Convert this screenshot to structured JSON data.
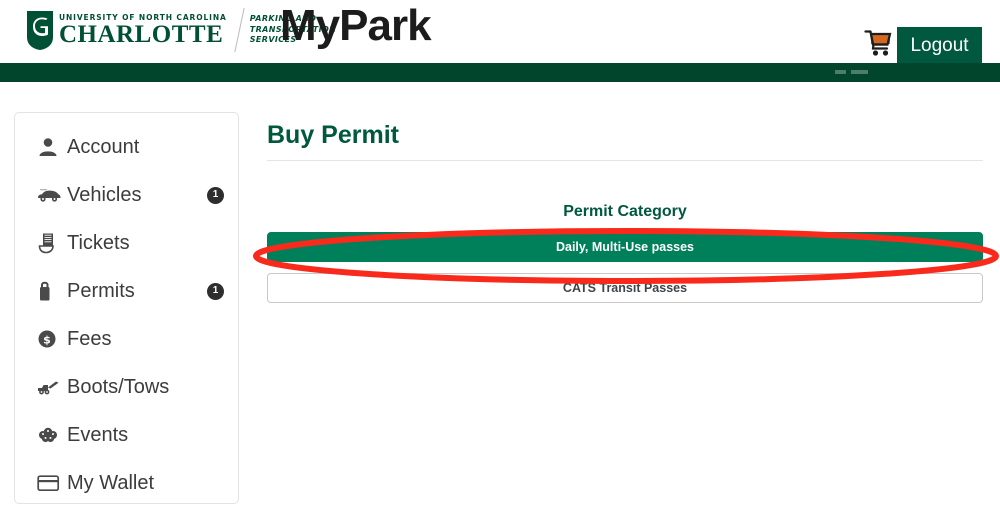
{
  "header": {
    "university_sup": "UNIVERSITY OF NORTH CAROLINA",
    "university_main": "CHARLOTTE",
    "dept_line1": "PARKING AND",
    "dept_line2": "TRANSPORTATION",
    "dept_line3": "SERVICES",
    "app_title": "MyPark",
    "cart_icon": "shopping-cart-icon",
    "logout_label": "Logout",
    "brand_green": "#005035",
    "navbar_green": "#00452c",
    "logout_green": "#00593f"
  },
  "sidebar": {
    "items": [
      {
        "label": "Account",
        "icon": "user-icon",
        "badge": ""
      },
      {
        "label": "Vehicles",
        "icon": "car-icon",
        "badge": "1"
      },
      {
        "label": "Tickets",
        "icon": "ticket-icon",
        "badge": ""
      },
      {
        "label": "Permits",
        "icon": "permit-tag-icon",
        "badge": "1"
      },
      {
        "label": "Fees",
        "icon": "dollar-coin-icon",
        "badge": ""
      },
      {
        "label": "Boots/Tows",
        "icon": "tow-truck-icon",
        "badge": ""
      },
      {
        "label": "Events",
        "icon": "events-icon",
        "badge": ""
      },
      {
        "label": "My Wallet",
        "icon": "wallet-card-icon",
        "badge": ""
      }
    ]
  },
  "main": {
    "page_title": "Buy Permit",
    "section_heading": "Permit Category",
    "categories": [
      {
        "label": "Daily, Multi-Use passes",
        "selected": true
      },
      {
        "label": "CATS Transit Passes",
        "selected": false
      }
    ],
    "accent_green": "#00805a",
    "title_green": "#00583d"
  },
  "annotation": {
    "shape": "red-ellipse-highlight",
    "target": "Daily, Multi-Use passes",
    "color": "#f92a1c"
  }
}
